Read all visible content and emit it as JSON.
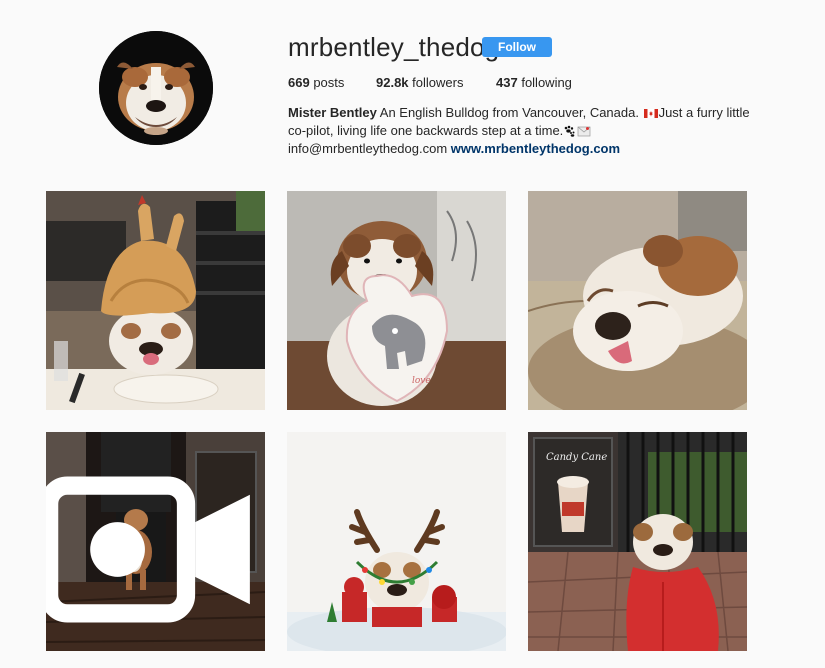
{
  "profile": {
    "username": "mrbentley_thedog",
    "follow_label": "Follow",
    "posts_count": "669",
    "posts_label": "posts",
    "followers_count": "92.8k",
    "followers_label": "followers",
    "following_count": "437",
    "following_label": "following",
    "full_name": "Mister Bentley",
    "bio_part1": " An English Bulldog from Vancouver, Canada. ",
    "bio_flag_icon": "canada-flag-icon",
    "bio_part2": "Just a furry little co-pilot, living life one backwards step at a time.",
    "bio_emoji_icons": [
      "paw-prints-icon",
      "envelope-icon"
    ],
    "email": "info@mrbentleythedog.com",
    "website": "www.mrbentleythedog.com"
  },
  "colors": {
    "follow_button": "#3897f0",
    "link": "#003569",
    "background": "#fafafa"
  },
  "posts": [
    {
      "id": "post-1",
      "subject": "bulldog wearing turkey hat at dinner table",
      "is_video": false
    },
    {
      "id": "post-2",
      "subject": "bulldog wearing elephant love bib",
      "is_video": false
    },
    {
      "id": "post-3",
      "subject": "bulldog sleeping on rug with tongue out",
      "is_video": false
    },
    {
      "id": "post-4",
      "subject": "bulldog walking behind person in doorway",
      "is_video": true,
      "icon": "video-camera-icon"
    },
    {
      "id": "post-5",
      "subject": "bulldog with reindeer antlers and holiday lights",
      "is_video": false
    },
    {
      "id": "post-6",
      "subject": "bulldog in red hoodie by candy cane hot chocolate sign",
      "is_video": false
    }
  ]
}
